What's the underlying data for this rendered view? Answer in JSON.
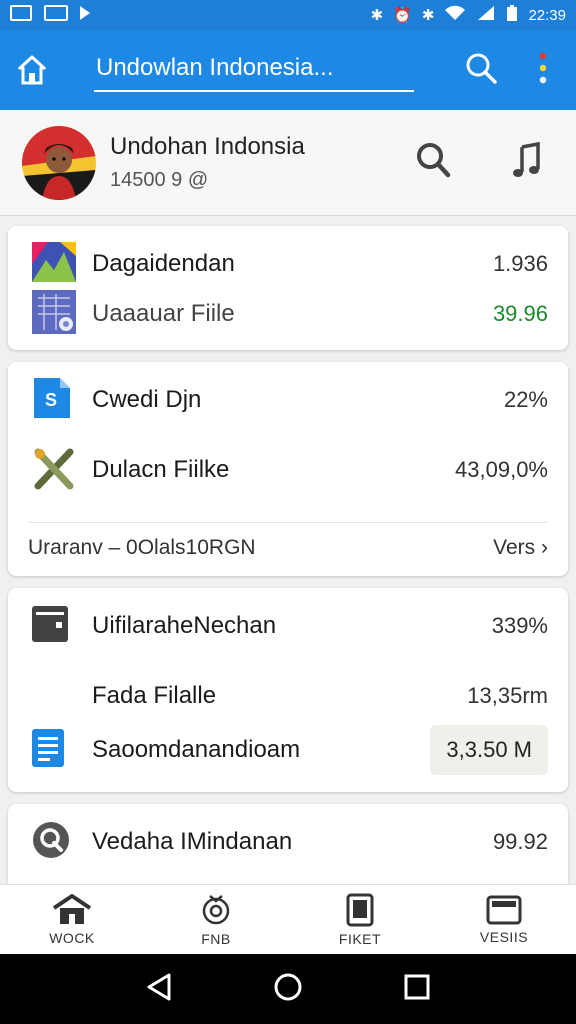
{
  "status_bar": {
    "time": "22:39",
    "icons": [
      "image-icon",
      "mail-icon",
      "play-icon",
      "bluetooth-icon",
      "alarm-icon",
      "bluetooth-icon",
      "wifi-icon",
      "signal-icon",
      "battery-icon"
    ]
  },
  "appbar": {
    "title": "Undowlan Indonesia..."
  },
  "profile": {
    "name": "Undohan Indonsia",
    "sub": "14500 9 @"
  },
  "card1": {
    "rows": [
      {
        "icon": "image-icon",
        "label": "Dagaidendan",
        "value": "1.936"
      },
      {
        "icon": "file-grid-icon",
        "label": "Uaaauar Fiile",
        "value": "39.96"
      }
    ]
  },
  "card2": {
    "rows": [
      {
        "icon": "s-file-icon",
        "label": "Cwedi Djn",
        "value": "22%"
      },
      {
        "icon": "tools-icon",
        "label": "Dulacn Fiilke",
        "value": "43,09,0%"
      }
    ],
    "footer_left": "Uraranv – 0Olals10RGN",
    "footer_right": "Vers"
  },
  "card3": {
    "rows": [
      {
        "icon": "folder-icon",
        "label": "UifilaraheNechan",
        "value": "339%"
      },
      {
        "icon": "",
        "label": "Fada Filalle",
        "value": "13,35rm"
      },
      {
        "icon": "document-icon",
        "label": "Saoomdanandioam",
        "value": "3,3.50 M"
      }
    ]
  },
  "card4": {
    "rows": [
      {
        "icon": "q-icon",
        "label": "Vedaha IMindanan",
        "value": "99.92"
      }
    ]
  },
  "bottom_nav": [
    {
      "label": "WOCK",
      "icon": "house-icon"
    },
    {
      "label": "FNB",
      "icon": "gear-badge-icon"
    },
    {
      "label": "FIKET",
      "icon": "tablet-icon"
    },
    {
      "label": "VESIIS",
      "icon": "photo-icon"
    }
  ],
  "colors": {
    "appbar": "#1e88e5",
    "status_bar": "#1e7fd8",
    "green_value": "#1a8a2c"
  }
}
